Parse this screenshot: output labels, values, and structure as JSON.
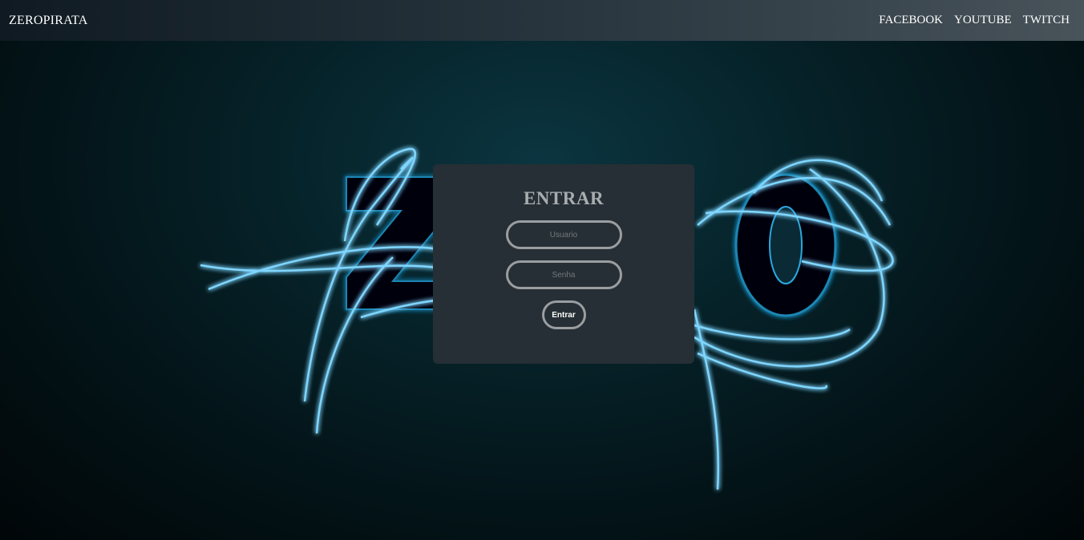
{
  "navbar": {
    "brand": "ZEROPIRATA",
    "links": [
      {
        "label": "FACEBOOK"
      },
      {
        "label": "YOUTUBE"
      },
      {
        "label": "TWITCH"
      }
    ]
  },
  "login": {
    "title": "ENTRAR",
    "username_placeholder": "Usuario",
    "password_placeholder": "Senha",
    "submit_label": "Entrar"
  },
  "colors": {
    "background": "#031418",
    "card": "#262f35",
    "neon": "#5cc8ff",
    "field_border": "#9a9ea1"
  }
}
